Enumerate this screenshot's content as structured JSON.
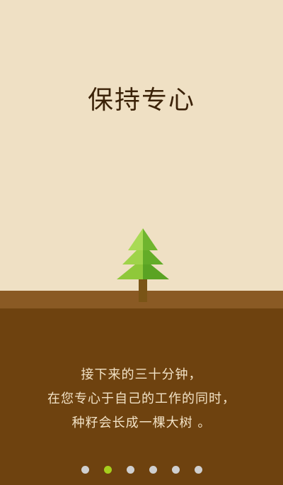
{
  "onboarding": {
    "title": "保持专心",
    "description_lines": [
      "接下来的三十分钟，",
      "在您专心于自己的工作的同时，",
      "种籽会长成一棵大树 。"
    ],
    "pagination": {
      "total_pages": 6,
      "current_page": 2
    }
  },
  "colors": {
    "sky": "#efe0c4",
    "ground_top": "#8a5a24",
    "ground": "#6e420f",
    "title_text": "#3b2208",
    "description_text": "#f2e2c6",
    "dot_inactive": "#cfcfcf",
    "dot_active": "#a6cf1d",
    "tree_light": "#9fd34a",
    "tree_dark": "#4f9a1e",
    "trunk": "#7a5416"
  },
  "icons": {
    "tree": "pine-tree-icon"
  }
}
